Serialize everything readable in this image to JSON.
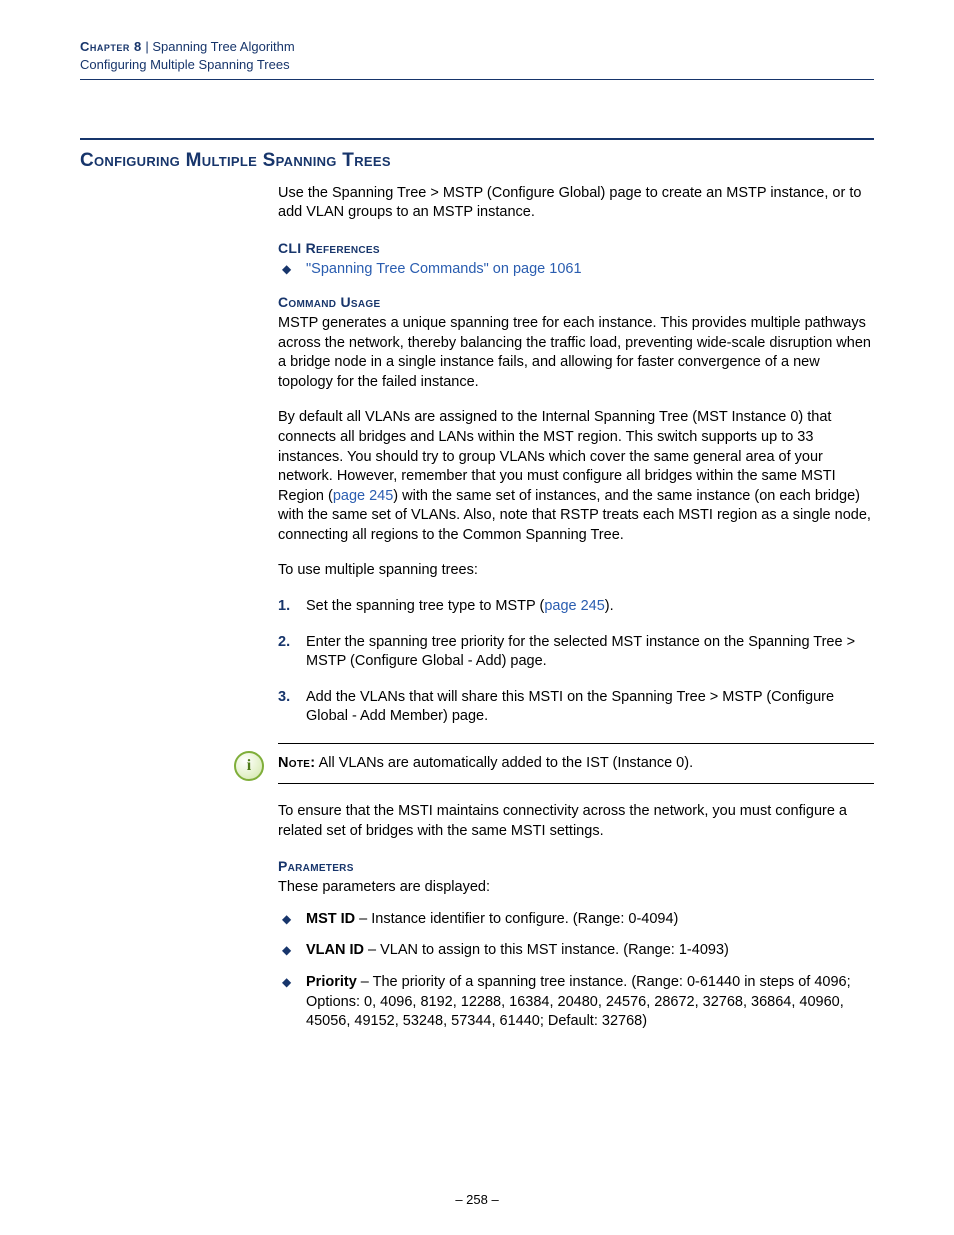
{
  "header": {
    "chapter_label": "Chapter 8",
    "separator": "  |  ",
    "chapter_title": "Spanning Tree Algorithm",
    "subsection": "Configuring Multiple Spanning Trees"
  },
  "title": "Configuring Multiple Spanning Trees",
  "intro": "Use the Spanning Tree > MSTP (Configure Global) page to create an MSTP instance, or to add VLAN groups to an MSTP instance.",
  "cli_ref": {
    "heading": "CLI References",
    "items": [
      "\"Spanning Tree Commands\" on page 1061"
    ]
  },
  "command_usage": {
    "heading": "Command Usage",
    "p1": "MSTP generates a unique spanning tree for each instance. This provides multiple pathways across the network, thereby balancing the traffic load, preventing wide-scale disruption when a bridge node in a single instance fails, and allowing for faster convergence of a new topology for the failed instance.",
    "p2_a": "By default all VLANs are assigned to the Internal Spanning Tree (MST Instance 0) that connects all bridges and LANs within the MST region. This switch supports up to 33 instances. You should try to group VLANs which cover the same general area of your network. However, remember that you must configure all bridges within the same MSTI Region (",
    "p2_link": "page 245",
    "p2_b": ") with the same set of instances, and the same instance (on each bridge) with the same set of VLANs. Also, note that RSTP treats each MSTI region as a single node, connecting all regions to the Common Spanning Tree.",
    "p3": "To use multiple spanning trees:",
    "steps": {
      "s1_a": "Set the spanning tree type to MSTP (",
      "s1_link": "page 245",
      "s1_b": ").",
      "s2": "Enter the spanning tree priority for the selected MST instance on the Spanning Tree > MSTP (Configure Global - Add) page.",
      "s3": "Add the VLANs that will share this MSTI on the Spanning Tree > MSTP (Configure Global - Add Member) page."
    }
  },
  "note": {
    "label": "Note:",
    "text": " All VLANs are automatically added to the IST (Instance 0)."
  },
  "post_note": "To ensure that the MSTI maintains connectivity across the network, you must configure a related set of bridges with the same MSTI settings.",
  "parameters": {
    "heading": "Parameters",
    "intro": "These parameters are displayed:",
    "items": [
      {
        "name": "MST ID",
        "desc": " – Instance identifier to configure. (Range: 0-4094)"
      },
      {
        "name": "VLAN ID",
        "desc": " – VLAN to assign to this MST instance. (Range: 1-4093)"
      },
      {
        "name": "Priority",
        "desc": " – The priority of a spanning tree instance. (Range: 0-61440 in steps of 4096; Options: 0, 4096, 8192, 12288, 16384, 20480, 24576, 28672, 32768, 36864, 40960, 45056, 49152, 53248, 57344, 61440; Default: 32768)"
      }
    ]
  },
  "footer": "–  258  –"
}
